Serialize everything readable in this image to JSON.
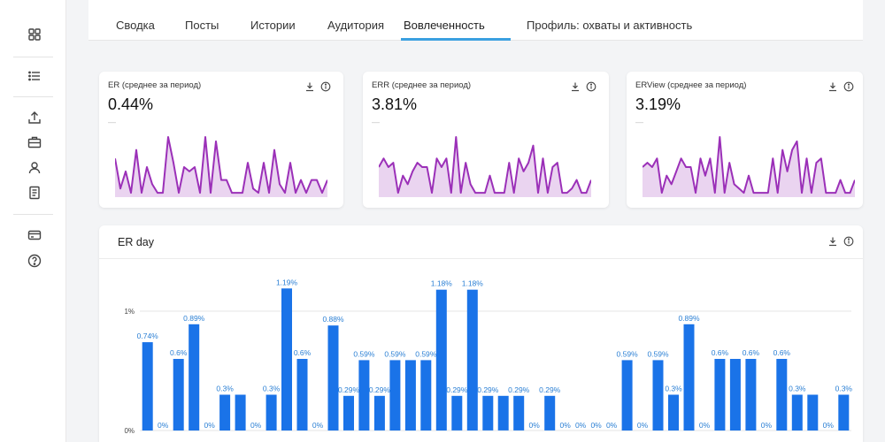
{
  "sidebar": {
    "icons": [
      {
        "name": "dashboard-grid-icon"
      },
      {
        "name": "list-icon"
      },
      {
        "name": "upload-icon"
      },
      {
        "name": "briefcase-icon"
      },
      {
        "name": "user-icon"
      },
      {
        "name": "document-icon"
      },
      {
        "name": "card-icon"
      },
      {
        "name": "help-icon"
      }
    ]
  },
  "tabs": [
    {
      "label": "Сводка"
    },
    {
      "label": "Посты"
    },
    {
      "label": "Истории"
    },
    {
      "label": "Аудитория"
    },
    {
      "label": "Вовлеченность",
      "active": true
    },
    {
      "label": "Профиль: охваты и активность"
    }
  ],
  "colors": {
    "accent": "#3ba0e0",
    "spark_line": "#9b30b8",
    "spark_fill": "#ead4f0",
    "bar": "#1a73e8",
    "bar_label": "#2a7fd4"
  },
  "cards": [
    {
      "title": "ER (среднее за период)",
      "value": "0.44%",
      "dash": "—",
      "spark": [
        45,
        10,
        30,
        5,
        55,
        5,
        35,
        15,
        5,
        5,
        70,
        40,
        5,
        35,
        30,
        35,
        5,
        70,
        5,
        65,
        20,
        20,
        5,
        5,
        5,
        40,
        10,
        5,
        40,
        5,
        55,
        15,
        5,
        40,
        5,
        20,
        5,
        20,
        20,
        5,
        20
      ]
    },
    {
      "title": "ERR (среднее за период)",
      "value": "3.81%",
      "dash": "—",
      "spark": [
        35,
        45,
        35,
        40,
        5,
        25,
        15,
        30,
        40,
        35,
        35,
        5,
        45,
        35,
        45,
        5,
        70,
        5,
        40,
        15,
        5,
        5,
        5,
        25,
        5,
        5,
        5,
        40,
        5,
        45,
        30,
        40,
        60,
        5,
        45,
        5,
        35,
        40,
        5,
        5,
        10,
        20,
        5,
        5,
        20
      ]
    },
    {
      "title": "ERView (среднее за период)",
      "value": "3.19%",
      "dash": "—",
      "spark": [
        35,
        40,
        35,
        45,
        5,
        25,
        15,
        30,
        45,
        35,
        35,
        5,
        45,
        25,
        45,
        5,
        70,
        5,
        40,
        15,
        10,
        5,
        25,
        5,
        5,
        5,
        5,
        45,
        5,
        55,
        30,
        55,
        65,
        5,
        45,
        5,
        40,
        45,
        5,
        5,
        5,
        20,
        5,
        5,
        20
      ]
    }
  ],
  "er_day": {
    "title": "ER day",
    "chart_data": {
      "type": "bar",
      "title": "ER day",
      "y_ticks": [
        "0%",
        "1%"
      ],
      "ylim": [
        0,
        1.25
      ],
      "grid": true,
      "values": [
        0.74,
        0,
        0.6,
        0.89,
        0,
        0.3,
        0.3,
        0,
        0.3,
        1.19,
        0.6,
        0,
        0.88,
        0.29,
        0.59,
        0.29,
        0.59,
        0.59,
        0.59,
        1.18,
        0.29,
        1.18,
        0.29,
        0.29,
        0.29,
        0,
        0.29,
        0,
        0,
        0,
        0,
        0.59,
        0,
        0.59,
        0.3,
        0.89,
        0,
        0.6,
        0.6,
        0.6,
        0,
        0.6,
        0.3,
        0.3,
        0,
        0.3
      ],
      "labels": [
        "0.74%",
        "0%",
        "0.6%",
        "0.89%",
        "0%",
        "0.3%",
        "",
        "0%",
        "0.3%",
        "1.19%",
        "0.6%",
        "0%",
        "0.88%",
        "0.29%",
        "0.59%",
        "0.29%",
        "0.59%",
        "",
        "0.59%",
        "1.18%",
        "0.29%",
        "1.18%",
        "0.29%",
        "",
        "0.29%",
        "0%",
        "0.29%",
        "0%",
        "0%",
        "0%",
        "0%",
        "0.59%",
        "0%",
        "0.59%",
        "0.3%",
        "0.89%",
        "0%",
        "0.6%",
        "",
        "0.6%",
        "0%",
        "0.6%",
        "0.3%",
        "",
        "0%",
        "0.3%"
      ]
    }
  }
}
